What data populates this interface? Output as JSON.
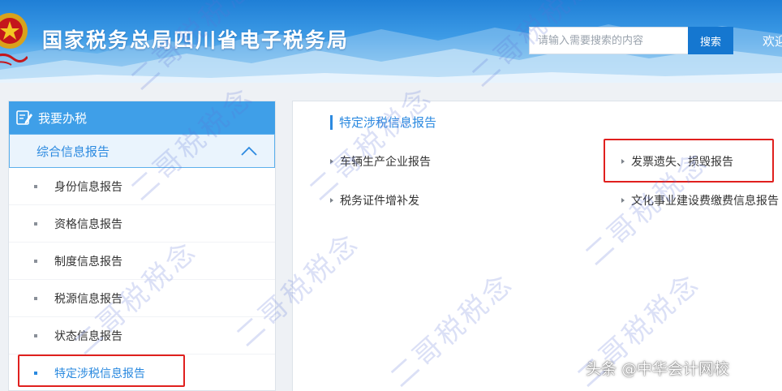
{
  "header": {
    "site_title": "国家税务总局四川省电子税务局",
    "search_placeholder": "请输入需要搜索的内容",
    "search_button": "搜索",
    "welcome_text": "欢迎"
  },
  "sidebar": {
    "heading": "我要办税",
    "group_label": "综合信息报告",
    "items": [
      {
        "label": "身份信息报告"
      },
      {
        "label": "资格信息报告"
      },
      {
        "label": "制度信息报告"
      },
      {
        "label": "税源信息报告"
      },
      {
        "label": "状态信息报告"
      },
      {
        "label": "特定涉税信息报告"
      }
    ]
  },
  "main": {
    "section_title": "特定涉税信息报告",
    "links": [
      {
        "label": "车辆生产企业报告"
      },
      {
        "label": "发票遗失、损毁报告"
      },
      {
        "label": "税务证件增补发"
      },
      {
        "label": "文化事业建设费缴费信息报告"
      }
    ]
  },
  "watermark": {
    "text": "二哥税税念"
  },
  "footer": {
    "source_mark": "头条 @中华会计网校"
  },
  "colors": {
    "accent": "#2c8ae0",
    "sidebar_head": "#3f9fe8",
    "highlight": "#e0201e"
  },
  "icons": {
    "sidebar_heading": "edit-icon",
    "group_toggle": "chevron-up-icon",
    "link_bullet": "triangle-right-icon"
  }
}
